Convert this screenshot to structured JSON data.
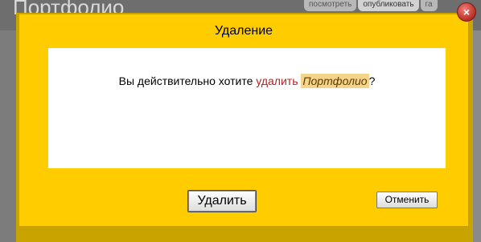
{
  "background": {
    "page_title": "Портфолио",
    "tabs": [
      {
        "label": "посмотреть",
        "active": false
      },
      {
        "label": "опубликовать",
        "active": true
      },
      {
        "label": "га",
        "active": false
      }
    ]
  },
  "dialog": {
    "title": "Удаление",
    "question": {
      "prefix": "Вы действительно хотите ",
      "verb": "удалить",
      "object": "Портфолио",
      "suffix": "?"
    },
    "buttons": {
      "delete": "Удалить",
      "cancel": "Отменить"
    },
    "close_icon": "close-icon"
  },
  "colors": {
    "dialog_bg": "#ffcc00",
    "verb_text": "#b22222",
    "object_highlight": "#f4d48a",
    "close_button": "#c0392b"
  }
}
